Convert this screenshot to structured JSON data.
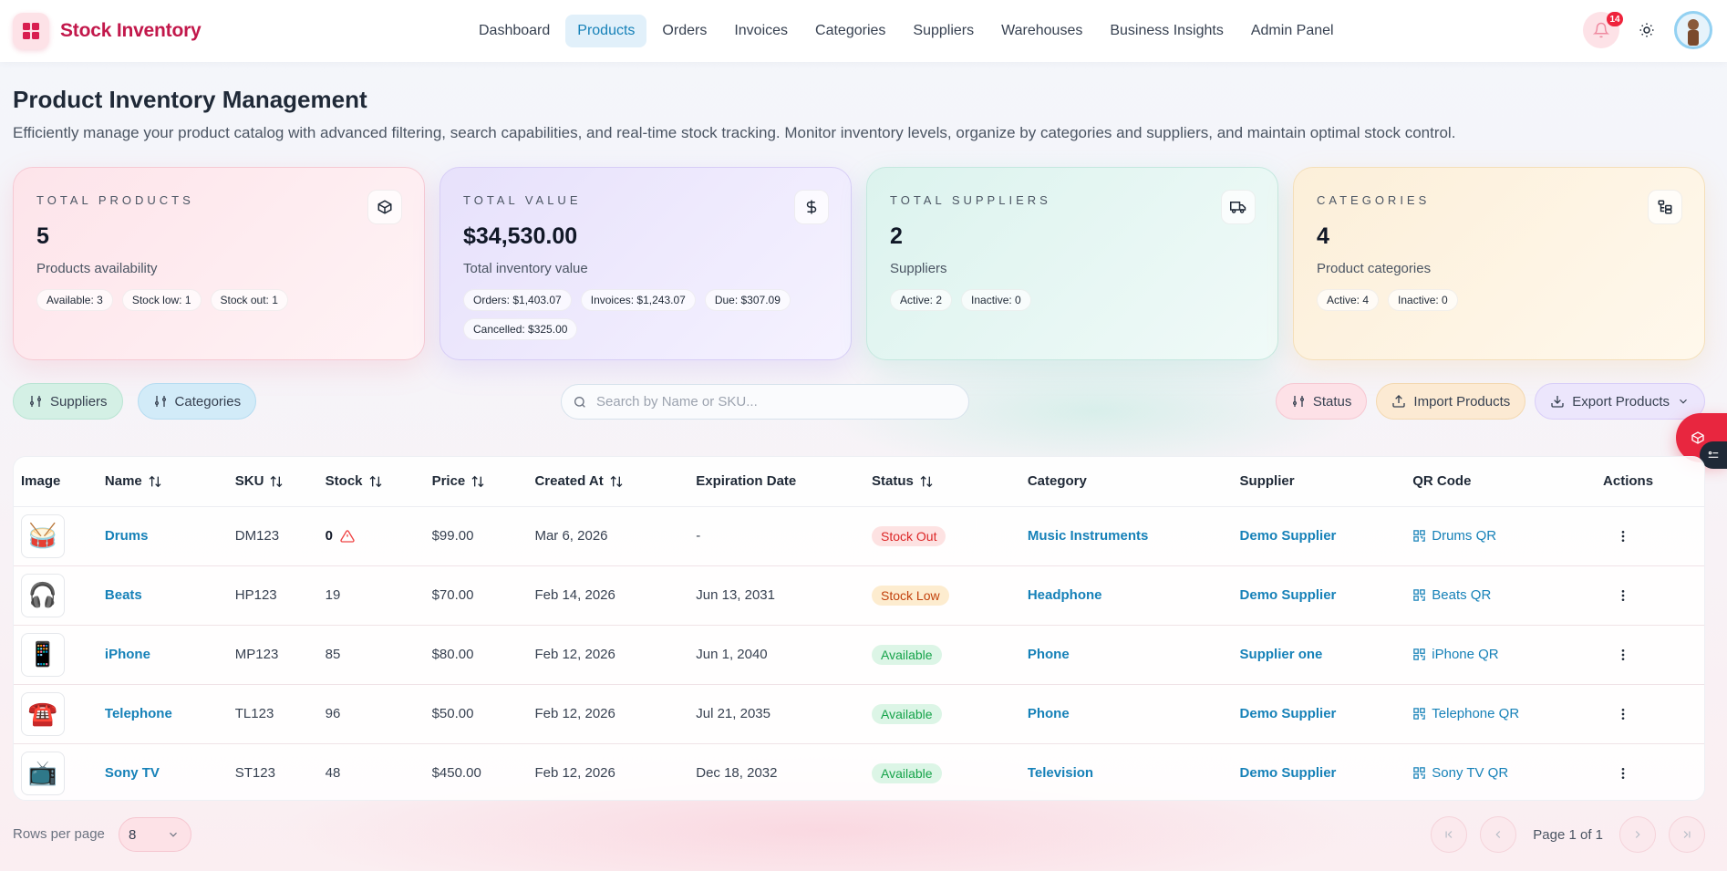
{
  "brand": {
    "name": "Stock Inventory"
  },
  "nav": {
    "items": [
      {
        "label": "Dashboard",
        "active": false
      },
      {
        "label": "Products",
        "active": true
      },
      {
        "label": "Orders",
        "active": false
      },
      {
        "label": "Invoices",
        "active": false
      },
      {
        "label": "Categories",
        "active": false
      },
      {
        "label": "Suppliers",
        "active": false
      },
      {
        "label": "Warehouses",
        "active": false
      },
      {
        "label": "Business Insights",
        "active": false
      },
      {
        "label": "Admin Panel",
        "active": false
      }
    ],
    "notification_count": "14"
  },
  "header": {
    "title": "Product Inventory Management",
    "description": "Efficiently manage your product catalog with advanced filtering, search capabilities, and real-time stock tracking. Monitor inventory levels, organize by categories and suppliers, and maintain optimal stock control."
  },
  "cards": [
    {
      "label": "TOTAL PRODUCTS",
      "value": "5",
      "subtitle": "Products availability",
      "icon": "box-icon",
      "chips": [
        "Available: 3",
        "Stock low: 1",
        "Stock out: 1"
      ]
    },
    {
      "label": "TOTAL VALUE",
      "value": "$34,530.00",
      "subtitle": "Total inventory value",
      "icon": "dollar-icon",
      "chips": [
        "Orders: $1,403.07",
        "Invoices: $1,243.07",
        "Due: $307.09",
        "Cancelled: $325.00"
      ]
    },
    {
      "label": "TOTAL SUPPLIERS",
      "value": "2",
      "subtitle": "Suppliers",
      "icon": "truck-icon",
      "chips": [
        "Active: 2",
        "Inactive: 0"
      ]
    },
    {
      "label": "CATEGORIES",
      "value": "4",
      "subtitle": "Product categories",
      "icon": "category-tree-icon",
      "chips": [
        "Active: 4",
        "Inactive: 0"
      ]
    }
  ],
  "toolbar": {
    "suppliers_label": "Suppliers",
    "categories_label": "Categories",
    "search_placeholder": "Search by Name or SKU...",
    "status_label": "Status",
    "import_label": "Import Products",
    "export_label": "Export Products"
  },
  "table": {
    "headers": {
      "image": "Image",
      "name": "Name",
      "sku": "SKU",
      "stock": "Stock",
      "price": "Price",
      "created_at": "Created At",
      "expiration": "Expiration Date",
      "status": "Status",
      "category": "Category",
      "supplier": "Supplier",
      "qr": "QR Code",
      "actions": "Actions"
    },
    "rows": [
      {
        "emoji": "🥁",
        "name": "Drums",
        "sku": "DM123",
        "stock": "0",
        "price": "$99.00",
        "created_at": "Mar 6, 2026",
        "expiration": "-",
        "status": "Stock Out",
        "status_kind": "out",
        "category": "Music Instruments",
        "supplier": "Demo Supplier",
        "qr": "Drums QR"
      },
      {
        "emoji": "🎧",
        "name": "Beats",
        "sku": "HP123",
        "stock": "19",
        "price": "$70.00",
        "created_at": "Feb 14, 2026",
        "expiration": "Jun 13, 2031",
        "status": "Stock Low",
        "status_kind": "low",
        "category": "Headphone",
        "supplier": "Demo Supplier",
        "qr": "Beats QR"
      },
      {
        "emoji": "📱",
        "name": "iPhone",
        "sku": "MP123",
        "stock": "85",
        "price": "$80.00",
        "created_at": "Feb 12, 2026",
        "expiration": "Jun 1, 2040",
        "status": "Available",
        "status_kind": "ok",
        "category": "Phone",
        "supplier": "Supplier one",
        "qr": "iPhone QR"
      },
      {
        "emoji": "☎️",
        "name": "Telephone",
        "sku": "TL123",
        "stock": "96",
        "price": "$50.00",
        "created_at": "Feb 12, 2026",
        "expiration": "Jul 21, 2035",
        "status": "Available",
        "status_kind": "ok",
        "category": "Phone",
        "supplier": "Demo Supplier",
        "qr": "Telephone QR"
      },
      {
        "emoji": "📺",
        "name": "Sony TV",
        "sku": "ST123",
        "stock": "48",
        "price": "$450.00",
        "created_at": "Feb 12, 2026",
        "expiration": "Dec 18, 2032",
        "status": "Available",
        "status_kind": "ok",
        "category": "Television",
        "supplier": "Demo Supplier",
        "qr": "Sony TV QR"
      }
    ]
  },
  "pagination": {
    "rows_per_page_label": "Rows per page",
    "rows_per_page": "8",
    "page_info": "Page 1 of 1"
  },
  "colors": {
    "brand": "#c2184b",
    "link": "#1681b8",
    "danger": "#e8263f"
  }
}
